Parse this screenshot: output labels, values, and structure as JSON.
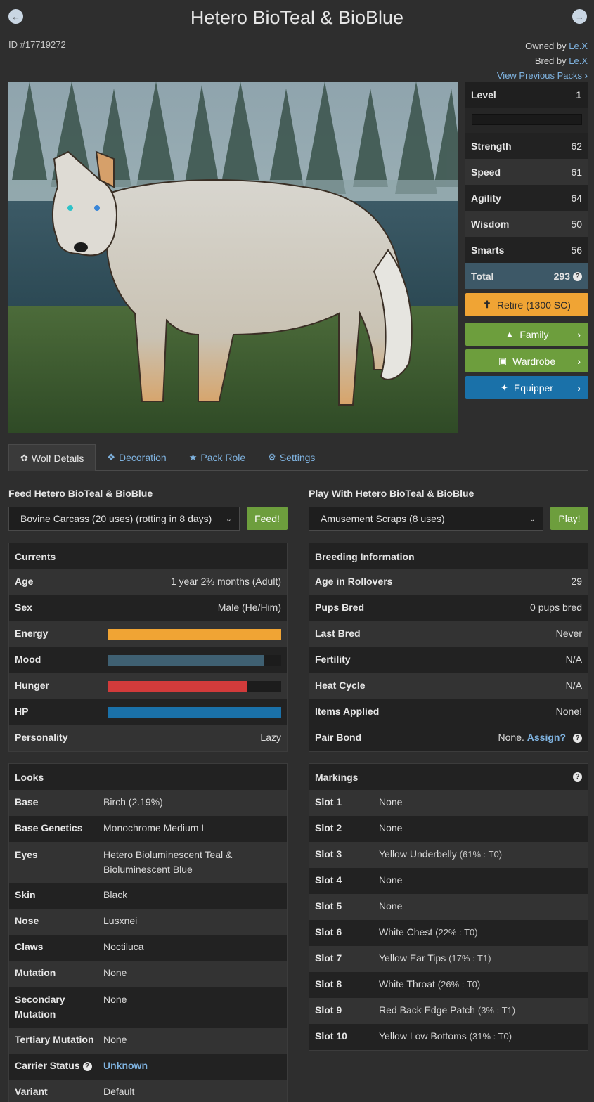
{
  "header": {
    "title": "Hetero BioTeal & BioBlue",
    "id_text": "ID #17719272",
    "owned_prefix": "Owned by ",
    "owner": "Le.X",
    "bred_prefix": "Bred by ",
    "breeder": "Le.X",
    "view_previous": "View Previous Packs",
    "prev_arrow_icon": "arrow-left-circle-icon",
    "next_arrow_icon": "arrow-right-circle-icon"
  },
  "stats": {
    "level_label": "Level",
    "level": "1",
    "xp_fraction": 0,
    "rows": [
      {
        "label": "Strength",
        "value": "62"
      },
      {
        "label": "Speed",
        "value": "61"
      },
      {
        "label": "Agility",
        "value": "64"
      },
      {
        "label": "Wisdom",
        "value": "50"
      },
      {
        "label": "Smarts",
        "value": "56"
      }
    ],
    "total_label": "Total",
    "total": "293"
  },
  "actions": {
    "retire": "Retire (1300 SC)",
    "family": "Family",
    "wardrobe": "Wardrobe",
    "equipper": "Equipper"
  },
  "tabs": [
    "Wolf Details",
    "Decoration",
    "Pack Role",
    "Settings"
  ],
  "feed": {
    "label": "Feed Hetero BioTeal & BioBlue",
    "selected": "Bovine Carcass (20 uses) (rotting in 8 days)",
    "button": "Feed!"
  },
  "play": {
    "label": "Play With Hetero BioTeal & BioBlue",
    "selected": "Amusement Scraps (8 uses)",
    "button": "Play!"
  },
  "currents": {
    "title": "Currents",
    "age_label": "Age",
    "age": "1 year 2⅔ months (Adult)",
    "sex_label": "Sex",
    "sex": "Male (He/Him)",
    "energy_label": "Energy",
    "energy": 1.0,
    "mood_label": "Mood",
    "mood": 0.9,
    "hunger_label": "Hunger",
    "hunger": 0.8,
    "hp_label": "HP",
    "hp": 1.0,
    "personality_label": "Personality",
    "personality": "Lazy",
    "colors": {
      "energy": "#f0a434",
      "mood": "#3f6072",
      "hunger": "#d23b3b",
      "hp": "#1a71a9"
    }
  },
  "breeding": {
    "title": "Breeding Information",
    "rows": [
      {
        "label": "Age in Rollovers",
        "value": "29"
      },
      {
        "label": "Pups Bred",
        "value": "0 pups bred"
      },
      {
        "label": "Last Bred",
        "value": "Never"
      },
      {
        "label": "Fertility",
        "value": "N/A"
      },
      {
        "label": "Heat Cycle",
        "value": "N/A"
      },
      {
        "label": "Items Applied",
        "value": "None!"
      }
    ],
    "pair_bond_label": "Pair Bond",
    "pair_bond_value": "None.",
    "pair_bond_link": "Assign?"
  },
  "looks": {
    "title": "Looks",
    "base_label": "Base",
    "base": "Birch (2.19%)",
    "base_genetics_label": "Base Genetics",
    "base_genetics": "Monochrome Medium I",
    "eyes_label": "Eyes",
    "eyes_line1": "Hetero Bioluminescent Teal &",
    "eyes_line2": "Bioluminescent Blue",
    "skin_label": "Skin",
    "skin": "Black",
    "nose_label": "Nose",
    "nose": "Lusxnei",
    "claws_label": "Claws",
    "claws": "Noctiluca",
    "mutation_label": "Mutation",
    "mutation": "None",
    "secondary_label_1": "Secondary",
    "secondary_label_2": "Mutation",
    "secondary": "None",
    "tertiary_label": "Tertiary Mutation",
    "tertiary": "None",
    "carrier_label": "Carrier Status",
    "carrier": "Unknown",
    "variant_label": "Variant",
    "variant": "Default"
  },
  "markings": {
    "title": "Markings",
    "slots": [
      {
        "label": "Slot 1",
        "name": "None",
        "detail": ""
      },
      {
        "label": "Slot 2",
        "name": "None",
        "detail": ""
      },
      {
        "label": "Slot 3",
        "name": "Yellow Underbelly",
        "detail": "(61% : T0)"
      },
      {
        "label": "Slot 4",
        "name": "None",
        "detail": ""
      },
      {
        "label": "Slot 5",
        "name": "None",
        "detail": ""
      },
      {
        "label": "Slot 6",
        "name": "White Chest",
        "detail": "(22% : T0)"
      },
      {
        "label": "Slot 7",
        "name": "Yellow Ear Tips",
        "detail": "(17% : T1)"
      },
      {
        "label": "Slot 8",
        "name": "White Throat",
        "detail": "(26% : T0)"
      },
      {
        "label": "Slot 9",
        "name": "Red Back Edge Patch",
        "detail": "(3% : T1)"
      },
      {
        "label": "Slot 10",
        "name": "Yellow Low Bottoms",
        "detail": "(31% : T0)"
      }
    ]
  }
}
